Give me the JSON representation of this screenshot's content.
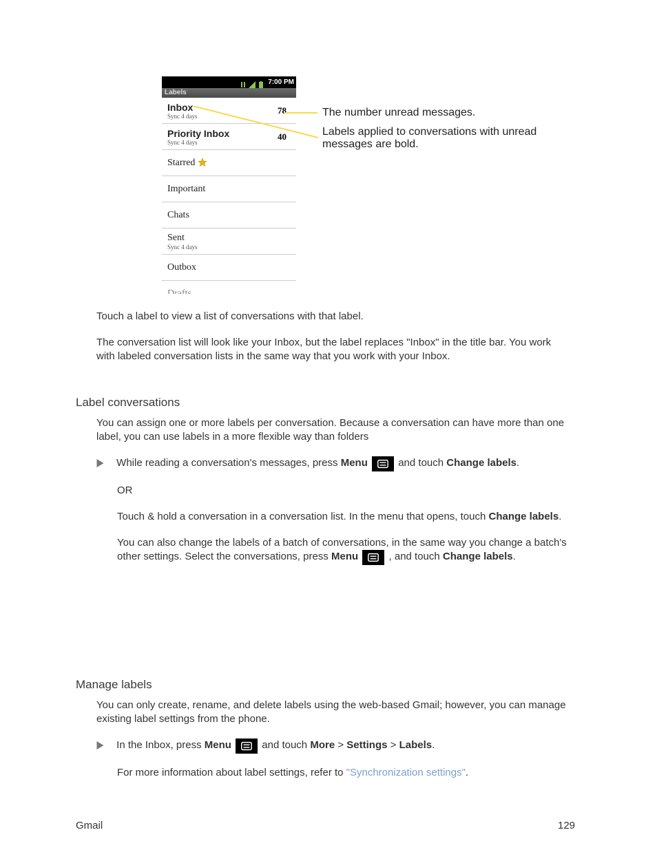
{
  "statusbar": {
    "time": "7:00 PM"
  },
  "screen_title": "Labels",
  "rows": {
    "inbox": {
      "label": "Inbox",
      "sub": "Sync 4 days",
      "count": "78"
    },
    "priority_inbox": {
      "label": "Priority Inbox",
      "sub": "Sync 4 days",
      "count": "40"
    },
    "starred": {
      "label": "Starred"
    },
    "important": {
      "label": "Important"
    },
    "chats": {
      "label": "Chats"
    },
    "sent": {
      "label": "Sent",
      "sub": "Sync 4 days"
    },
    "outbox": {
      "label": "Outbox"
    },
    "drafts": {
      "label": "Drafts"
    }
  },
  "annot": {
    "a1": "The number unread messages.",
    "a2": "Labels applied to conversations with unread messages are bold."
  },
  "body": {
    "p1a": "Touch a label to view a list of conversations with that label.",
    "p1b": "The conversation list will look like your Inbox, but the label replaces \"Inbox\" in the title bar. You work with labeled conversation lists in the same way that you work with your Inbox.",
    "h2": "Label conversations",
    "p2a": "You can assign one or more labels per conversation. Because a conversation can have more than one label, you can use labels in a more flexible way than folders",
    "step1_pre": "While reading a conversation's messages, press ",
    "step1_mid": "Menu",
    "step1_post": " and touch ",
    "step1_label": "Change labels",
    "or": "OR",
    "alt_a": "Touch & hold a conversation in a conversation list. In the menu that opens, touch ",
    "alt_b": "Change labels",
    "alt_c": "You can also change the labels of a batch of conversations, in the same way you change a batch's other settings. Select the conversations, press ",
    "alt_d": "Menu",
    "alt_e": ", and touch ",
    "alt_f": "Change labels",
    "h3": "Manage labels",
    "p3a": "You can only create, rename, and delete labels using the web-based Gmail; however, you can manage existing label settings from the phone.",
    "step2_pre": "In the Inbox, press ",
    "step2_mid": "Menu",
    "step2_post": " and touch ",
    "step2_a": "More",
    "step2_b": " > ",
    "step2_c": "Settings",
    "step2_d": " > ",
    "step2_e": "Labels",
    "p3b": "For more information about label settings, refer to ",
    "xref": "\"Synchronization settings\"",
    "footer_app": "Gmail",
    "footer_page": "129"
  }
}
